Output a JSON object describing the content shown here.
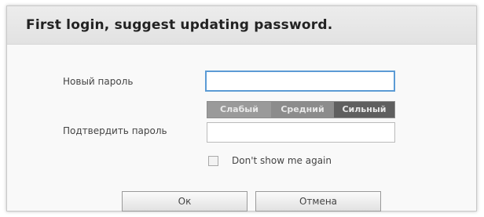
{
  "dialog": {
    "title": "First login, suggest updating password."
  },
  "form": {
    "new_password_label": "Новый пароль",
    "new_password_value": "",
    "confirm_password_label": "Подтвердить пароль",
    "confirm_password_value": "",
    "strength": {
      "weak": "Слабый",
      "medium": "Средний",
      "strong": "Сильный"
    },
    "dont_show_label": "Don't show me again",
    "dont_show_checked": false
  },
  "buttons": {
    "ok": "Ок",
    "cancel": "Отмена"
  },
  "colors": {
    "focus_border": "#5b9bd5",
    "strength_weak": "#9a9a9a",
    "strength_medium": "#8c8c8c",
    "strength_strong": "#5f5f5f"
  }
}
